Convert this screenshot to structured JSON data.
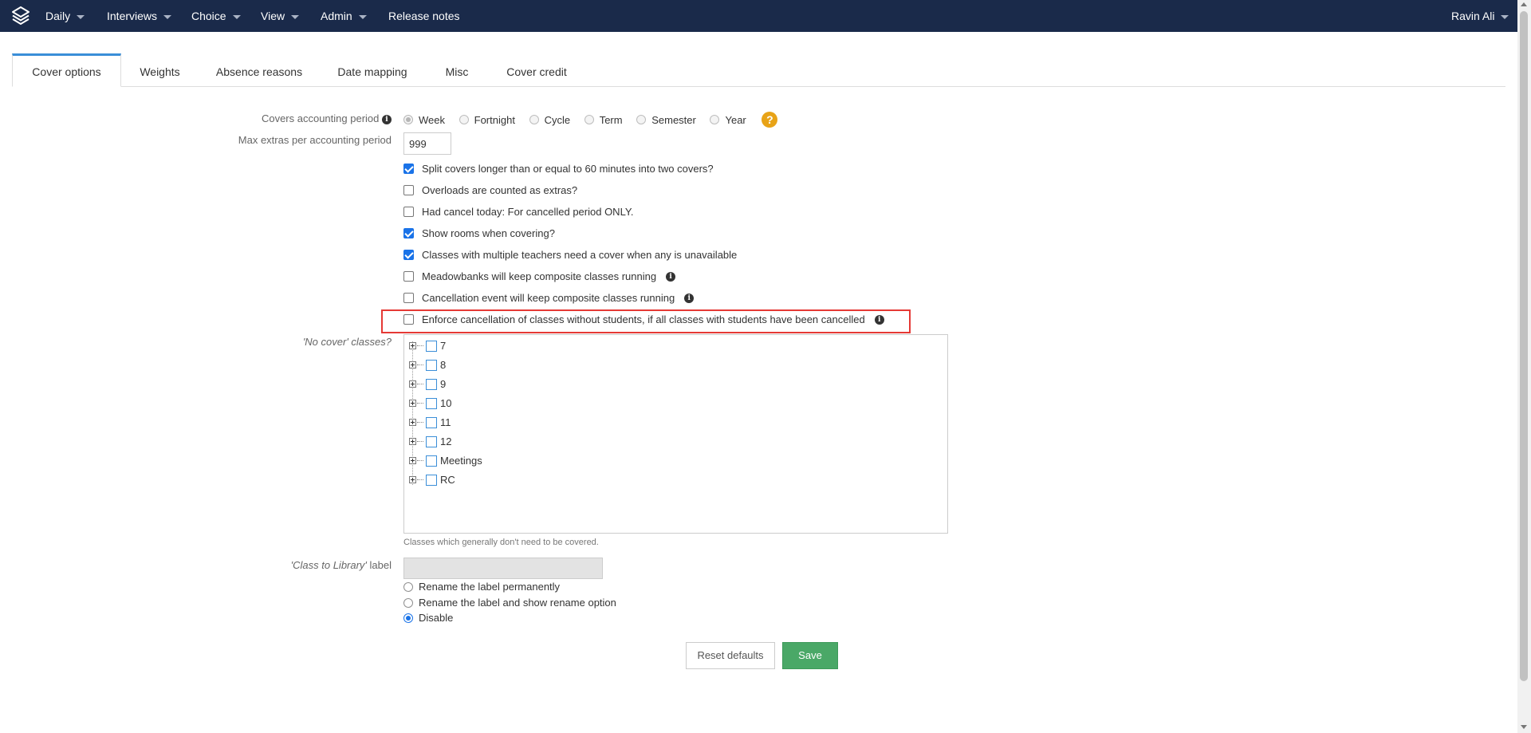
{
  "navbar": {
    "menus": [
      {
        "label": "Daily",
        "has_caret": true
      },
      {
        "label": "Interviews",
        "has_caret": true
      },
      {
        "label": "Choice",
        "has_caret": true
      },
      {
        "label": "View",
        "has_caret": true
      },
      {
        "label": "Admin",
        "has_caret": true
      },
      {
        "label": "Release notes",
        "has_caret": false
      }
    ],
    "user_name": "Ravin Ali",
    "background": "#1a2a4a"
  },
  "tabs": [
    {
      "label": "Cover options",
      "active": true
    },
    {
      "label": "Weights",
      "active": false
    },
    {
      "label": "Absence reasons",
      "active": false
    },
    {
      "label": "Date mapping",
      "active": false
    },
    {
      "label": "Misc",
      "active": false
    },
    {
      "label": "Cover credit",
      "active": false
    }
  ],
  "form": {
    "accounting_period": {
      "label": "Covers accounting period",
      "options": [
        "Week",
        "Fortnight",
        "Cycle",
        "Term",
        "Semester",
        "Year"
      ],
      "selected": "Week",
      "disabled": true,
      "help": "?"
    },
    "max_extras": {
      "label": "Max extras per accounting period",
      "value": "999"
    },
    "checkboxes": [
      {
        "label": "Split covers longer than or equal to 60 minutes into two covers?",
        "checked": true,
        "info": false
      },
      {
        "label": "Overloads are counted as extras?",
        "checked": false,
        "info": false
      },
      {
        "label": "Had cancel today: For cancelled period ONLY.",
        "checked": false,
        "info": false
      },
      {
        "label": "Show rooms when covering?",
        "checked": true,
        "info": false
      },
      {
        "label": "Classes with multiple teachers need a cover when any is unavailable",
        "checked": true,
        "info": false
      },
      {
        "label": "Meadowbanks will keep composite classes running",
        "checked": false,
        "info": true
      },
      {
        "label": "Cancellation event will keep composite classes running",
        "checked": false,
        "info": true
      },
      {
        "label": "Enforce cancellation of classes without students, if all classes with students have been cancelled",
        "checked": false,
        "info": true,
        "highlighted": true
      }
    ],
    "no_cover": {
      "label": "'No cover' classes?",
      "items": [
        "7",
        "8",
        "9",
        "10",
        "11",
        "12",
        "Meetings",
        "RC"
      ],
      "help": "Classes which generally don't need to be covered."
    },
    "class_to_library": {
      "label_italic": "'Class to Library'",
      "label_rest": " label",
      "value": "",
      "options": [
        "Rename the label permanently",
        "Rename the label and show rename option",
        "Disable"
      ],
      "selected": "Disable"
    },
    "buttons": {
      "reset": "Reset defaults",
      "save": "Save"
    }
  },
  "colors": {
    "accent": "#1a73e8",
    "tab_active_border": "#3a8ed8",
    "highlight": "#e53935",
    "save": "#4aa867",
    "help_badge": "#e8a317"
  }
}
